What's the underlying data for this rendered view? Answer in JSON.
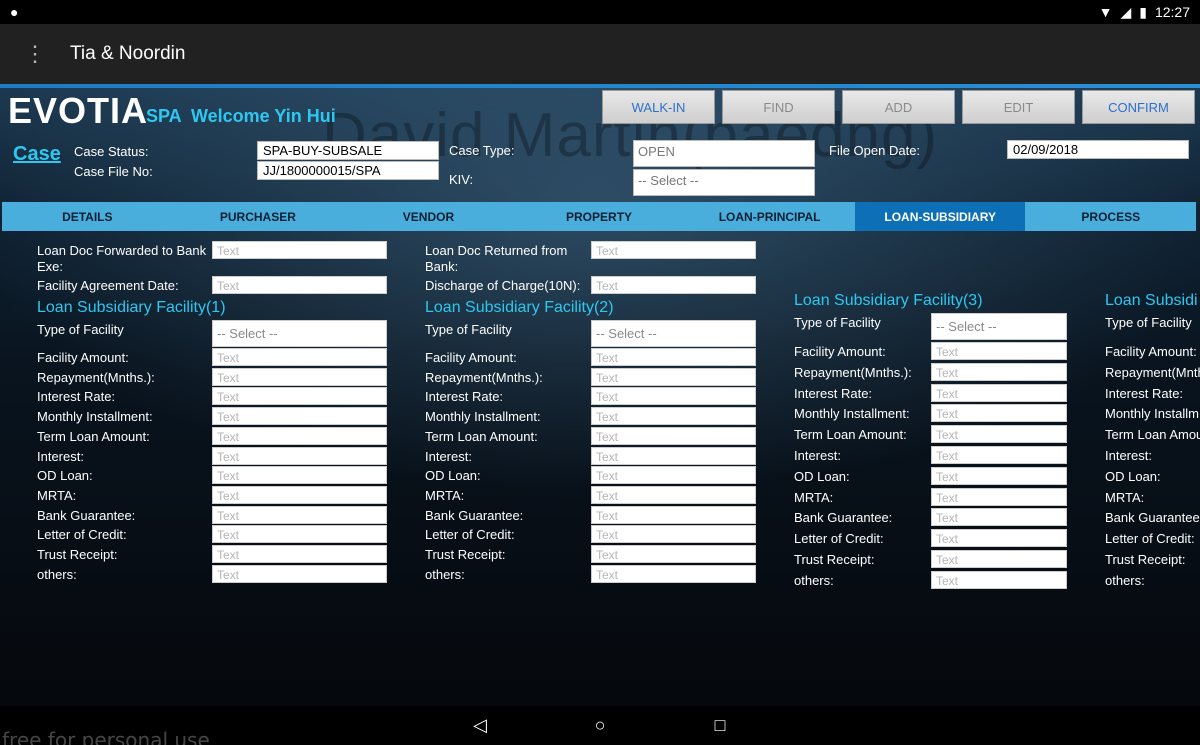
{
  "status_bar": {
    "time": "12:27"
  },
  "app_bar": {
    "title": "Tia & Noordin"
  },
  "brand": {
    "name": "EVOTIA",
    "spa": "SPA",
    "welcome": "Welcome Yin Hui"
  },
  "watermark": "David Martin(baedng)",
  "buttons": {
    "walkin": "WALK-IN",
    "find": "FIND",
    "add": "ADD",
    "edit": "EDIT",
    "confirm": "CONFIRM"
  },
  "case": {
    "title": "Case",
    "status_label": "Case Status:",
    "status_value": "SPA-BUY-SUBSALE",
    "fileno_label": "Case File No:",
    "fileno_value": "JJ/1800000015/SPA",
    "type_label": "Case Type:",
    "type_value": "OPEN",
    "kiv_label": "KIV:",
    "kiv_value": "-- Select --",
    "open_date_label": "File Open Date:",
    "open_date_value": "02/09/2018"
  },
  "tabs": [
    "DETAILS",
    "PURCHASER",
    "VENDOR",
    "PROPERTY",
    "LOAN-PRINCIPAL",
    "LOAN-SUBSIDIARY",
    "PROCESS"
  ],
  "top_form": {
    "doc_forwarded_label": "Loan Doc Forwarded to Bank Exe:",
    "doc_returned_label": "Loan Doc Returned from Bank:",
    "facility_date_label": "Facility Agreement Date:",
    "discharge_label": "Discharge of Charge(10N):",
    "placeholder": "Text"
  },
  "facility": {
    "titles": [
      "Loan Subsidiary Facility(1)",
      "Loan Subsidiary Facility(2)",
      "Loan Subsidiary Facility(3)",
      "Loan Subsidi"
    ],
    "type_label": "Type of Facility",
    "select_placeholder": "-- Select --",
    "text_placeholder": "Text",
    "fields": [
      "Facility Amount:",
      "Repayment(Mnths.):",
      "Interest Rate:",
      "Monthly Installment:",
      "Term Loan Amount:",
      "Interest:",
      "OD Loan:",
      "MRTA:",
      "Bank Guarantee:",
      "Letter of Credit:",
      "Trust Receipt:",
      "others:"
    ],
    "fields_cut": [
      "Facility Amount:",
      "Repayment(Mnth",
      "Interest Rate:",
      "Monthly Installm",
      "Term Loan Amou",
      "Interest:",
      "OD Loan:",
      "MRTA:",
      "Bank Guarantee:",
      "Letter of Credit:",
      "Trust Receipt:",
      "others:"
    ]
  },
  "footer_note": "free for personal use"
}
